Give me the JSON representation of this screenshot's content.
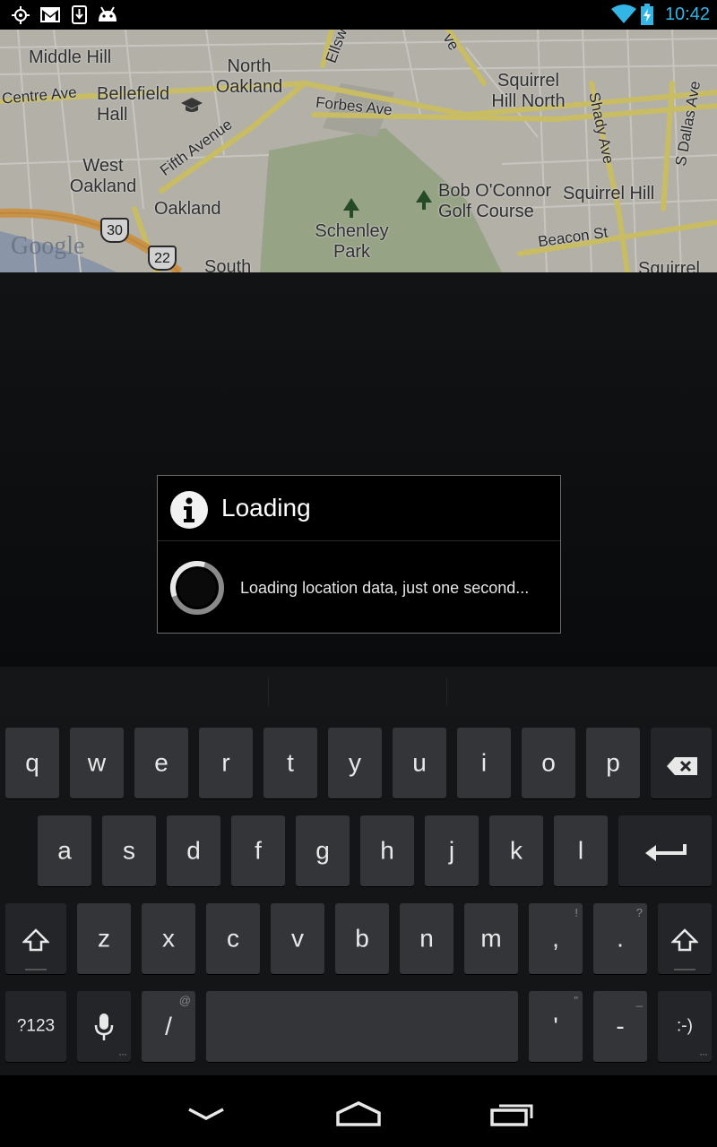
{
  "status_bar": {
    "time": "10:42",
    "icons": [
      "gps-icon",
      "gmail-icon",
      "download-icon",
      "android-icon",
      "wifi-icon",
      "battery-charging-icon"
    ],
    "accent_color": "#33b5e5"
  },
  "map": {
    "watermark": "Google",
    "places": [
      "Middle Hill",
      "North Oakland",
      "Bellefield Hall",
      "West Oakland",
      "Oakland",
      "Squirrel Hill North",
      "Bob O'Connor Golf Course",
      "Squirrel Hill",
      "Schenley Park",
      "South",
      "Squirrel"
    ],
    "roads": [
      "Centre Ave",
      "Fifth Avenue",
      "Forbes Ave",
      "Shady Ave",
      "S Dallas Ave",
      "Beacon St",
      "Ellsw",
      "ve"
    ],
    "shields": [
      "30",
      "22"
    ]
  },
  "dialog": {
    "title": "Loading",
    "message": "Loading location data, just one second..."
  },
  "keyboard": {
    "row1": [
      "q",
      "w",
      "e",
      "r",
      "t",
      "y",
      "u",
      "i",
      "o",
      "p"
    ],
    "row2": [
      "a",
      "s",
      "d",
      "f",
      "g",
      "h",
      "j",
      "k",
      "l"
    ],
    "row3": [
      "z",
      "x",
      "c",
      "v",
      "b",
      "n",
      "m",
      ",",
      "."
    ],
    "row3_hints": [
      "!",
      "?"
    ],
    "row4": {
      "symbols": "?123",
      "slash": "/",
      "slash_hint": "@",
      "apostrophe": "'",
      "apostrophe_hint": "\"",
      "dash": "-",
      "dash_hint": "_",
      "smiley": ":-)"
    }
  }
}
